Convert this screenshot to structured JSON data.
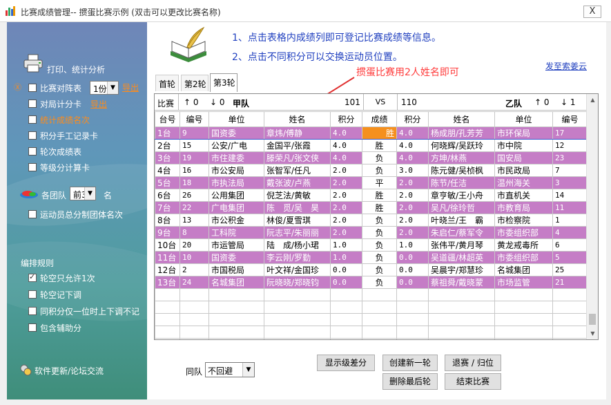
{
  "window": {
    "title": "比赛成绩管理--  掼蛋比赛示例 (双击可以更改比赛名称)",
    "close": "X"
  },
  "sidebar": {
    "print_section": "打印、统计分析",
    "items": [
      {
        "label": "比赛对阵表",
        "checked": false
      },
      {
        "label": "对局计分卡",
        "checked": false
      },
      {
        "label": "统计成绩名次",
        "checked": false
      },
      {
        "label": "积分手工记录卡",
        "checked": false
      },
      {
        "label": "轮次成绩表",
        "checked": false
      },
      {
        "label": "等级分计算卡",
        "checked": false
      }
    ],
    "copies_value": "1份",
    "export1": "导出",
    "export2": "导出",
    "rank_prefix": "各团队",
    "rank_value": "前3",
    "rank_suffix": "名",
    "athlete_team_rank": "运动员总分制团体名次",
    "rules_title": "编排规则",
    "rules": [
      {
        "label": "轮空只允许1次",
        "checked": true
      },
      {
        "label": "轮空记下调",
        "checked": false
      },
      {
        "label": "同积分仅一位时上下调不记",
        "checked": false
      },
      {
        "label": "包含辅助分",
        "checked": false
      }
    ],
    "update_link": "软件更新/论坛交流"
  },
  "main": {
    "instruction1": "1、点击表格内成绩列即可登记比赛成绩等信息。",
    "instruction2": "2、点击不同积分可以交换运动员位置。",
    "contact": "发至索姜云",
    "annotation": "掼蛋比赛用2人姓名即可",
    "tabs": [
      "首轮",
      "第2轮",
      "第3轮"
    ],
    "team_row": {
      "label": "比赛",
      "left_up": "↑ 0",
      "left_down": "↓ 0",
      "left_team": "甲队",
      "left_score": "101",
      "vs": "VS",
      "right_score": "110",
      "right_team": "乙队",
      "right_up": "↑ 0",
      "right_down": "↓ 1"
    },
    "headers": [
      "台号",
      "编号",
      "单位",
      "姓名",
      "积分",
      "成绩",
      "积分",
      "姓名",
      "单位",
      "编号"
    ],
    "rows": [
      {
        "table": "1台",
        "no1": "9",
        "unit1": "国资委",
        "name1": "章炜/傅静",
        "pts1": "4.0",
        "result": "胜",
        "pts2": "4.0",
        "name2": "杨成朋/孔芳芳",
        "unit2": "市环保局",
        "no2": "17"
      },
      {
        "table": "2台",
        "no1": "15",
        "unit1": "公安/广电",
        "name1": "金国平/张霞",
        "pts1": "4.0",
        "result": "胜",
        "pts2": "4.0",
        "name2": "何晓辉/吴跃玲",
        "unit2": "市中院",
        "no2": "12"
      },
      {
        "table": "3台",
        "no1": "19",
        "unit1": "市住建委",
        "name1": "滕荣凡/张文侠",
        "pts1": "4.0",
        "result": "负",
        "pts2": "4.0",
        "name2": "方坤/林燕",
        "unit2": "国安局",
        "no2": "23"
      },
      {
        "table": "4台",
        "no1": "16",
        "unit1": "市公安局",
        "name1": "张智军/任凡",
        "pts1": "2.0",
        "result": "负",
        "pts2": "3.0",
        "name2": "陈元健/吴桢枫",
        "unit2": "市民政局",
        "no2": "7"
      },
      {
        "table": "5台",
        "no1": "18",
        "unit1": "市执法局",
        "name1": "戴张波/卢燕",
        "pts1": "2.0",
        "result": "平",
        "pts2": "2.0",
        "name2": "陈节/任洁",
        "unit2": "温州海关",
        "no2": "3"
      },
      {
        "table": "6台",
        "no1": "26",
        "unit1": "公用集团",
        "name1": "倪芝法/黄敏",
        "pts1": "2.0",
        "result": "胜",
        "pts2": "2.0",
        "name2": "章亨敏/王小舟",
        "unit2": "市直机关",
        "no2": "14"
      },
      {
        "table": "7台",
        "no1": "22",
        "unit1": "广电集团",
        "name1": "陈　觅/吴　昊",
        "pts1": "2.0",
        "result": "胜",
        "pts2": "2.0",
        "name2": "吴凡/徐玲哲",
        "unit2": "市教育局",
        "no2": "11"
      },
      {
        "table": "8台",
        "no1": "13",
        "unit1": "市公积金",
        "name1": "林俊/夏雪琪",
        "pts1": "2.0",
        "result": "负",
        "pts2": "2.0",
        "name2": "叶晓兰/王　霸",
        "unit2": "市检察院",
        "no2": "1"
      },
      {
        "table": "9台",
        "no1": "8",
        "unit1": "工科院",
        "name1": "阮志平/朱丽丽",
        "pts1": "2.0",
        "result": "负",
        "pts2": "2.0",
        "name2": "朱启仁/蔡军令",
        "unit2": "市委组织部",
        "no2": "4"
      },
      {
        "table": "10台",
        "no1": "20",
        "unit1": "市运管局",
        "name1": "陆　成/杨小珺",
        "pts1": "1.0",
        "result": "负",
        "pts2": "1.0",
        "name2": "张伟平/黄月琴",
        "unit2": "黄龙戒毒所",
        "no2": "6"
      },
      {
        "table": "11台",
        "no1": "10",
        "unit1": "国资委",
        "name1": "李云刚/罗勤",
        "pts1": "1.0",
        "result": "负",
        "pts2": "0.0",
        "name2": "吴道疆/林超英",
        "unit2": "市委组织部",
        "no2": "5"
      },
      {
        "table": "12台",
        "no1": "2",
        "unit1": "市国税局",
        "name1": "叶文祥/金国珍",
        "pts1": "0.0",
        "result": "负",
        "pts2": "0.0",
        "name2": "吴晨宇/郑慧珍",
        "unit2": "名城集团",
        "no2": "25"
      },
      {
        "table": "13台",
        "no1": "24",
        "unit1": "名城集团",
        "name1": "阮晓晓/郑晓钧",
        "pts1": "0.0",
        "result": "负",
        "pts2": "0.0",
        "name2": "蔡祖舜/戴晓蒙",
        "unit2": "市场监管",
        "no2": "21"
      }
    ],
    "same_team_label": "同队",
    "same_team_value": "不回避",
    "buttons": {
      "show_diff": "显示级差分",
      "new_round": "创建新一轮",
      "withdraw": "退赛 / 归位",
      "delete_last": "删除最后轮",
      "end_match": "结束比赛"
    }
  }
}
